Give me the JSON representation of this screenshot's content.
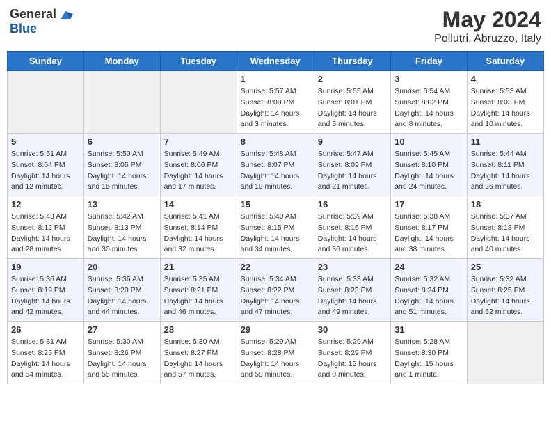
{
  "header": {
    "logo_general": "General",
    "logo_blue": "Blue",
    "month": "May 2024",
    "location": "Pollutri, Abruzzo, Italy"
  },
  "days_of_week": [
    "Sunday",
    "Monday",
    "Tuesday",
    "Wednesday",
    "Thursday",
    "Friday",
    "Saturday"
  ],
  "weeks": [
    [
      {
        "num": "",
        "info": ""
      },
      {
        "num": "",
        "info": ""
      },
      {
        "num": "",
        "info": ""
      },
      {
        "num": "1",
        "info": "Sunrise: 5:57 AM\nSunset: 8:00 PM\nDaylight: 14 hours and 3 minutes."
      },
      {
        "num": "2",
        "info": "Sunrise: 5:55 AM\nSunset: 8:01 PM\nDaylight: 14 hours and 5 minutes."
      },
      {
        "num": "3",
        "info": "Sunrise: 5:54 AM\nSunset: 8:02 PM\nDaylight: 14 hours and 8 minutes."
      },
      {
        "num": "4",
        "info": "Sunrise: 5:53 AM\nSunset: 8:03 PM\nDaylight: 14 hours and 10 minutes."
      }
    ],
    [
      {
        "num": "5",
        "info": "Sunrise: 5:51 AM\nSunset: 8:04 PM\nDaylight: 14 hours and 12 minutes."
      },
      {
        "num": "6",
        "info": "Sunrise: 5:50 AM\nSunset: 8:05 PM\nDaylight: 14 hours and 15 minutes."
      },
      {
        "num": "7",
        "info": "Sunrise: 5:49 AM\nSunset: 8:06 PM\nDaylight: 14 hours and 17 minutes."
      },
      {
        "num": "8",
        "info": "Sunrise: 5:48 AM\nSunset: 8:07 PM\nDaylight: 14 hours and 19 minutes."
      },
      {
        "num": "9",
        "info": "Sunrise: 5:47 AM\nSunset: 8:09 PM\nDaylight: 14 hours and 21 minutes."
      },
      {
        "num": "10",
        "info": "Sunrise: 5:45 AM\nSunset: 8:10 PM\nDaylight: 14 hours and 24 minutes."
      },
      {
        "num": "11",
        "info": "Sunrise: 5:44 AM\nSunset: 8:11 PM\nDaylight: 14 hours and 26 minutes."
      }
    ],
    [
      {
        "num": "12",
        "info": "Sunrise: 5:43 AM\nSunset: 8:12 PM\nDaylight: 14 hours and 28 minutes."
      },
      {
        "num": "13",
        "info": "Sunrise: 5:42 AM\nSunset: 8:13 PM\nDaylight: 14 hours and 30 minutes."
      },
      {
        "num": "14",
        "info": "Sunrise: 5:41 AM\nSunset: 8:14 PM\nDaylight: 14 hours and 32 minutes."
      },
      {
        "num": "15",
        "info": "Sunrise: 5:40 AM\nSunset: 8:15 PM\nDaylight: 14 hours and 34 minutes."
      },
      {
        "num": "16",
        "info": "Sunrise: 5:39 AM\nSunset: 8:16 PM\nDaylight: 14 hours and 36 minutes."
      },
      {
        "num": "17",
        "info": "Sunrise: 5:38 AM\nSunset: 8:17 PM\nDaylight: 14 hours and 38 minutes."
      },
      {
        "num": "18",
        "info": "Sunrise: 5:37 AM\nSunset: 8:18 PM\nDaylight: 14 hours and 40 minutes."
      }
    ],
    [
      {
        "num": "19",
        "info": "Sunrise: 5:36 AM\nSunset: 8:19 PM\nDaylight: 14 hours and 42 minutes."
      },
      {
        "num": "20",
        "info": "Sunrise: 5:36 AM\nSunset: 8:20 PM\nDaylight: 14 hours and 44 minutes."
      },
      {
        "num": "21",
        "info": "Sunrise: 5:35 AM\nSunset: 8:21 PM\nDaylight: 14 hours and 46 minutes."
      },
      {
        "num": "22",
        "info": "Sunrise: 5:34 AM\nSunset: 8:22 PM\nDaylight: 14 hours and 47 minutes."
      },
      {
        "num": "23",
        "info": "Sunrise: 5:33 AM\nSunset: 8:23 PM\nDaylight: 14 hours and 49 minutes."
      },
      {
        "num": "24",
        "info": "Sunrise: 5:32 AM\nSunset: 8:24 PM\nDaylight: 14 hours and 51 minutes."
      },
      {
        "num": "25",
        "info": "Sunrise: 5:32 AM\nSunset: 8:25 PM\nDaylight: 14 hours and 52 minutes."
      }
    ],
    [
      {
        "num": "26",
        "info": "Sunrise: 5:31 AM\nSunset: 8:25 PM\nDaylight: 14 hours and 54 minutes."
      },
      {
        "num": "27",
        "info": "Sunrise: 5:30 AM\nSunset: 8:26 PM\nDaylight: 14 hours and 55 minutes."
      },
      {
        "num": "28",
        "info": "Sunrise: 5:30 AM\nSunset: 8:27 PM\nDaylight: 14 hours and 57 minutes."
      },
      {
        "num": "29",
        "info": "Sunrise: 5:29 AM\nSunset: 8:28 PM\nDaylight: 14 hours and 58 minutes."
      },
      {
        "num": "30",
        "info": "Sunrise: 5:29 AM\nSunset: 8:29 PM\nDaylight: 15 hours and 0 minutes."
      },
      {
        "num": "31",
        "info": "Sunrise: 5:28 AM\nSunset: 8:30 PM\nDaylight: 15 hours and 1 minute."
      },
      {
        "num": "",
        "info": ""
      }
    ]
  ]
}
